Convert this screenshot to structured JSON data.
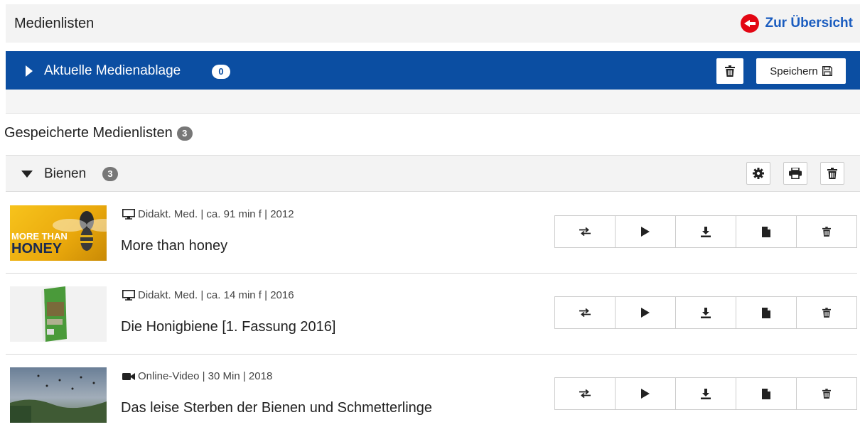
{
  "header": {
    "title": "Medienlisten",
    "back_label": "Zur Übersicht",
    "back_icon": "arrow-left-circle-icon"
  },
  "current": {
    "label": "Aktuelle Medienablage",
    "count": "0",
    "save_label": "Speichern"
  },
  "saved": {
    "heading": "Gespeicherte Medienlisten",
    "count": "3"
  },
  "group": {
    "name": "Bienen",
    "count": "3"
  },
  "items": [
    {
      "meta": "Didakt. Med. | ca. 91 min f | 2012",
      "type_icon": "monitor-icon",
      "title": "More than honey",
      "thumb_text_1": "MORE THAN",
      "thumb_text_2": "HONEY"
    },
    {
      "meta": "Didakt. Med. | ca. 14 min f | 2016",
      "type_icon": "monitor-icon",
      "title": "Die Honigbiene [1. Fassung 2016]"
    },
    {
      "meta": "Online-Video | 30 Min | 2018",
      "type_icon": "video-camera-icon",
      "title": "Das leise Sterben der Bienen und Schmetterlinge"
    }
  ],
  "colors": {
    "accent_blue": "#0b4ea2",
    "link_blue": "#1a5cbf",
    "back_red": "#e30613",
    "badge_grey": "#777777"
  }
}
